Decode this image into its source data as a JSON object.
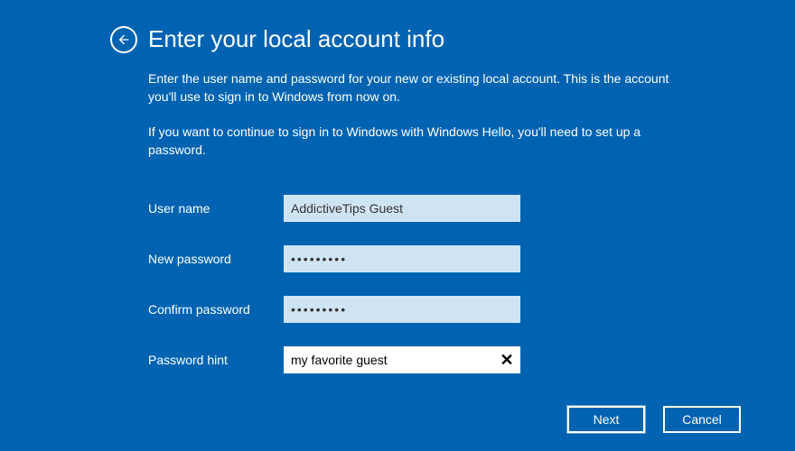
{
  "header": {
    "title": "Enter your local account info"
  },
  "intro": {
    "para1": "Enter the user name and password for your new or existing local account. This is the account you'll use to sign in to Windows from now on.",
    "para2": "If you want to continue to sign in to Windows with Windows Hello, you'll need to set up a password."
  },
  "form": {
    "username_label": "User name",
    "username_value": "AddictiveTips Guest",
    "newpassword_label": "New password",
    "newpassword_value": "•••••••••",
    "confirmpassword_label": "Confirm password",
    "confirmpassword_value": "•••••••••",
    "hint_label": "Password hint",
    "hint_value": "my favorite guest"
  },
  "footer": {
    "next_label": "Next",
    "cancel_label": "Cancel"
  }
}
